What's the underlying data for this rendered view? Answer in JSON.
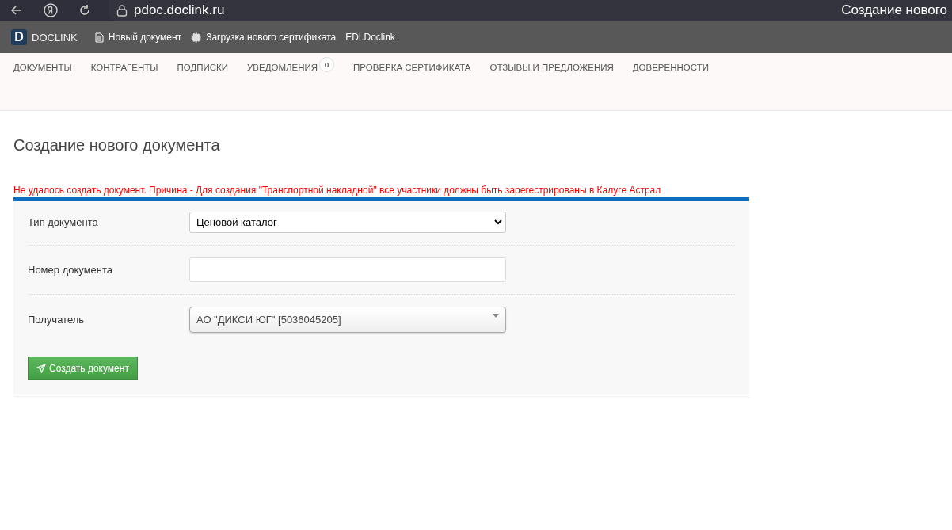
{
  "browser": {
    "url": "pdoc.doclink.ru",
    "tab_title": "Создание нового"
  },
  "bookmarks": [
    {
      "kind": "logo",
      "label": "DOCLINK",
      "logo_letter": "D"
    },
    {
      "kind": "doc",
      "label": "Новый документ"
    },
    {
      "kind": "gear",
      "label": "Загрузка нового сертификата"
    },
    {
      "kind": "plain",
      "label": "EDI.Doclink"
    }
  ],
  "nav": [
    {
      "label": "ДОКУМЕНТЫ"
    },
    {
      "label": "КОНТРАГЕНТЫ"
    },
    {
      "label": "ПОДПИСКИ"
    },
    {
      "label": "УВЕДОМЛЕНИЯ",
      "badge": "0"
    },
    {
      "label": "ПРОВЕРКА СЕРТИФИКАТА"
    },
    {
      "label": "ОТЗЫВЫ И ПРЕДЛОЖЕНИЯ"
    },
    {
      "label": "ДОВЕРЕННОСТИ"
    }
  ],
  "page_title": "Создание нового документа",
  "error": "Не удалось создать документ. Причина - Для создания \"Транспортной накладной\" все участники должны быть зарегестрированы в Калуге Астрал",
  "form": [
    {
      "kind": "select",
      "label": "Тип документа",
      "value": "Ценовой каталог"
    },
    {
      "kind": "input",
      "label": "Номер документа"
    },
    {
      "kind": "combo",
      "label": "Получатель",
      "value": "АО \"ДИКСИ ЮГ\" [5036045205]"
    }
  ],
  "submit": "Создать документ"
}
